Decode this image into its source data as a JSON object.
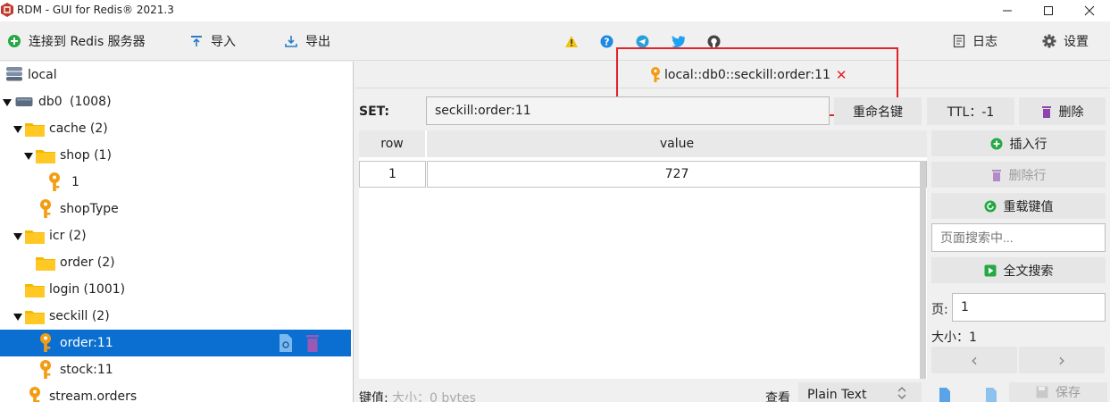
{
  "window": {
    "title": "RDM - GUI for Redis® 2021.3",
    "minimize_glyph": "—",
    "maximize_glyph": "☐",
    "close_glyph": "✕"
  },
  "left_toolbar": {
    "connect": "连接到 Redis 服务器",
    "import": "导入",
    "export": "导出"
  },
  "right_toolbar": {
    "icons": [
      "warning-icon",
      "help-icon",
      "telegram-icon",
      "twitter-icon",
      "github-icon"
    ],
    "log": "日志",
    "settings": "设置"
  },
  "tree": {
    "connection": "local",
    "database": "db0",
    "database_count": "(1008)",
    "nodes": [
      {
        "label": "cache",
        "count": "(2)",
        "type": "folder"
      },
      {
        "label": "shop",
        "count": "(1)",
        "type": "folder"
      },
      {
        "label": "1",
        "count": "",
        "type": "key"
      },
      {
        "label": "shopType",
        "count": "",
        "type": "key"
      },
      {
        "label": "icr",
        "count": "(2)",
        "type": "folder"
      },
      {
        "label": "order",
        "count": "(2)",
        "type": "folder"
      },
      {
        "label": "login",
        "count": "(1001)",
        "type": "folder"
      },
      {
        "label": "seckill",
        "count": "(2)",
        "type": "folder"
      },
      {
        "label": "order:11",
        "count": "",
        "type": "key",
        "selected": true
      },
      {
        "label": "stock:11",
        "count": "",
        "type": "key"
      },
      {
        "label": "stream.orders",
        "count": "",
        "type": "key"
      }
    ]
  },
  "tab": {
    "label": "local::db0::seckill:order:11",
    "close_glyph": "✕"
  },
  "key_view": {
    "type_label": "SET:",
    "key_name": "seckill:order:11",
    "rename": "重命名键",
    "ttl": "TTL：-1",
    "delete": "删除"
  },
  "table": {
    "columns": [
      "row",
      "value"
    ],
    "rows": [
      {
        "row": "1",
        "value": "727"
      }
    ]
  },
  "side_panel": {
    "insert_row": "插入行",
    "delete_row": "删除行",
    "reload": "重载键值",
    "search_placeholder": "页面搜索中...",
    "full_search": "全文搜索",
    "page_label": "页:",
    "page_value": "1",
    "size_label": "大小：1",
    "prev_glyph": "‹",
    "next_glyph": "›"
  },
  "footer": {
    "key_value_label": "键值:",
    "size_text": "大小：0 bytes",
    "view_label": "查看",
    "format": "Plain Text",
    "save": "保存"
  },
  "colors": {
    "selection": "#0a6fd0",
    "folder": "#f5b800",
    "key": "#f39c12",
    "accent_green": "#27a844",
    "highlight_box": "#e0222a",
    "delete_purple": "#8e44ad"
  }
}
